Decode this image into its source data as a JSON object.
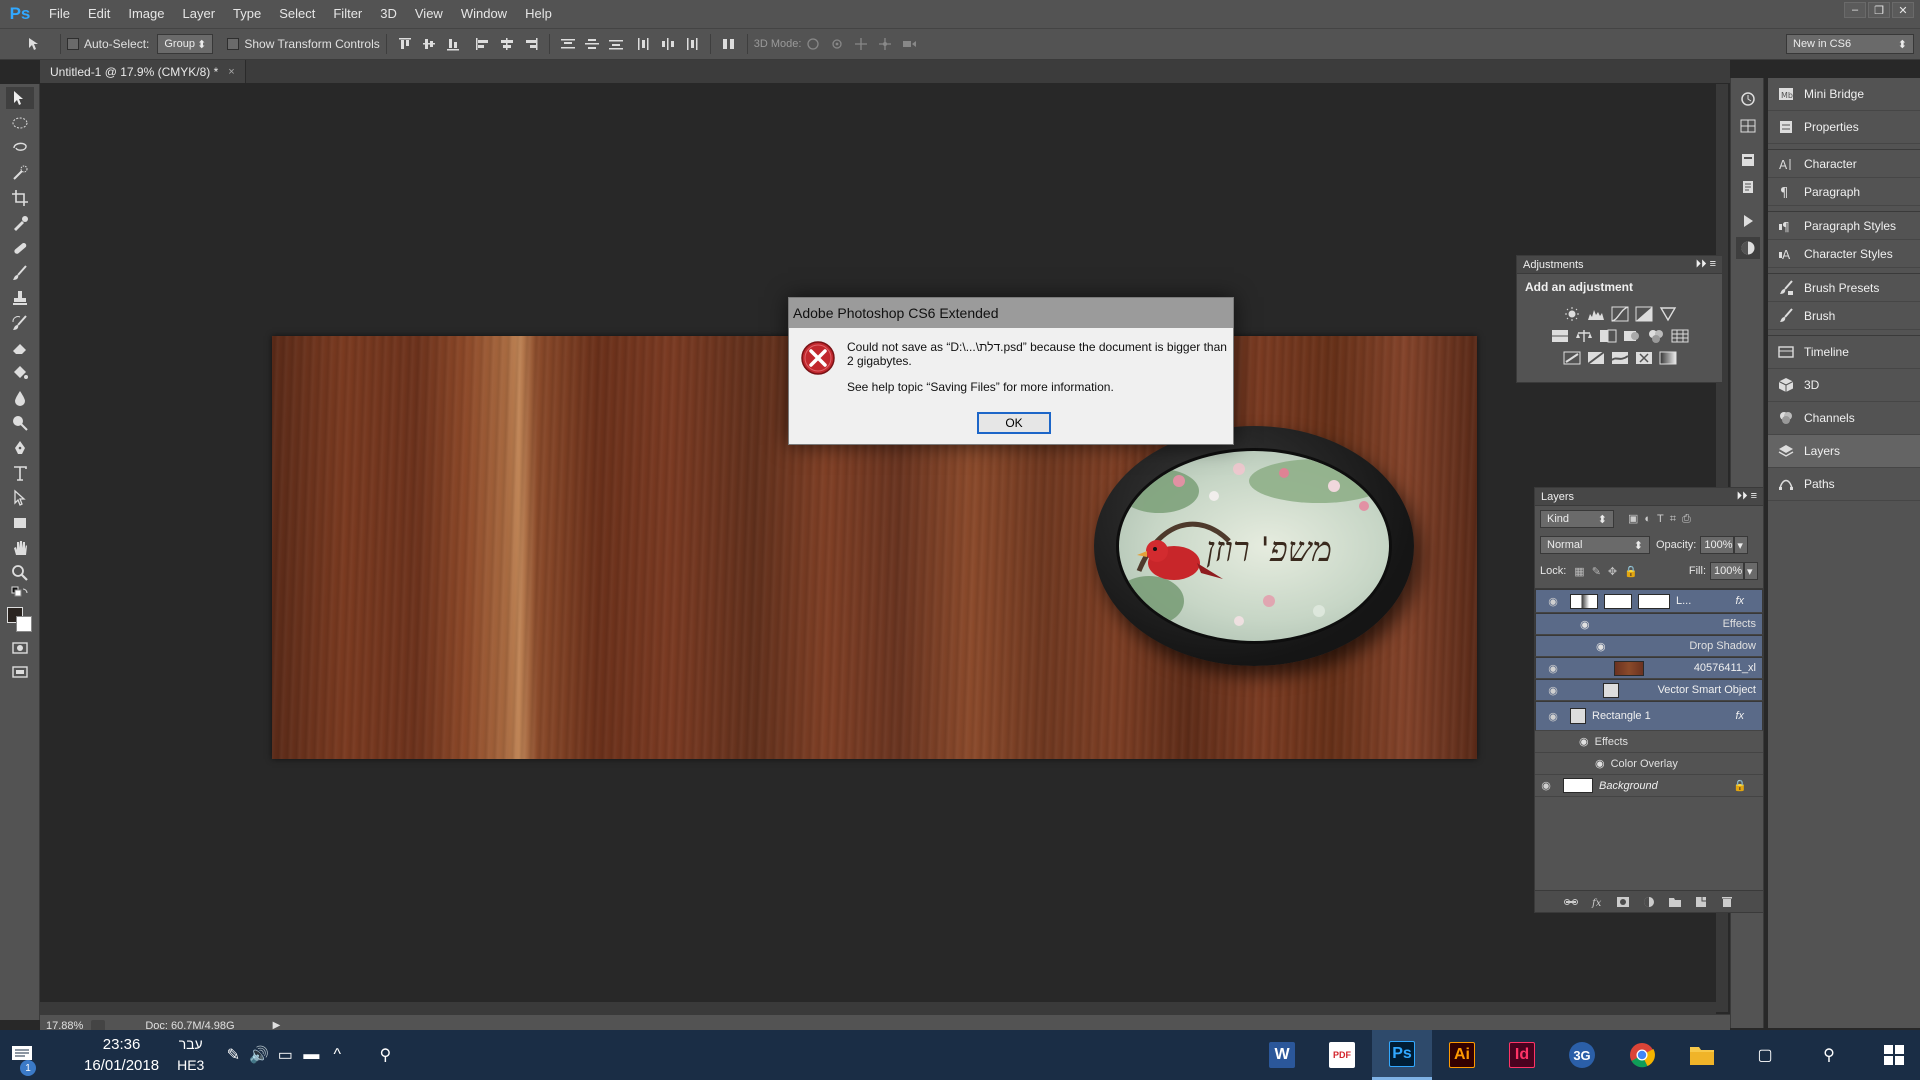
{
  "app": {
    "logo": "Ps",
    "menu": [
      "File",
      "Edit",
      "Image",
      "Layer",
      "Type",
      "Select",
      "Filter",
      "3D",
      "View",
      "Window",
      "Help"
    ]
  },
  "options": {
    "auto_select_label": "Auto-Select:",
    "auto_select_value": "Group",
    "transform_label": "Show Transform Controls",
    "mode3d_label": "3D Mode:",
    "workspace": "New in CS6"
  },
  "document": {
    "tab_title": "Untitled-1 @ 17.9% (CMYK/8) *",
    "tab_close": "×"
  },
  "status": {
    "zoom": "17.88%",
    "doc_size": "Doc: 60.7M/4.98G"
  },
  "panels_list": [
    "Mini Bridge",
    "Properties",
    "Character",
    "Paragraph",
    "Paragraph Styles",
    "Character Styles",
    "Brush Presets",
    "Brush",
    "Timeline",
    "3D",
    "Channels",
    "Layers",
    "Paths"
  ],
  "adjustments": {
    "title": "Adjustments",
    "subtitle": "Add an adjustment"
  },
  "layers": {
    "title": "Layers",
    "kind": "Kind",
    "blend_mode": "Normal",
    "opacity_label": "Opacity:",
    "opacity": "100%",
    "lock_label": "Lock:",
    "fill_label": "Fill:",
    "fill": "100%",
    "rows": [
      {
        "name": "L...",
        "fx": "fx",
        "effects": "Effects",
        "effect": "Drop Shadow"
      },
      {
        "name": "40576411_xl"
      },
      {
        "name": "Vector Smart Object"
      },
      {
        "name": "Rectangle 1",
        "fx": "fx",
        "effects": "Effects",
        "effect": "Color Overlay"
      },
      {
        "name": "Background"
      }
    ]
  },
  "dialog": {
    "title": "Adobe Photoshop CS6 Extended",
    "message": "Could not save as “D:\\...\\דלת.psd” because the document is bigger than 2 gigabytes.",
    "help": "See help topic “Saving Files” for more information.",
    "ok": "OK"
  },
  "plaque_text": "משפ' רוזן",
  "taskbar": {
    "time": "23:36",
    "date": "16/01/2018",
    "lang": "עבר",
    "lang_code": "HE3",
    "notifications": "1",
    "apps": [
      "W",
      "PDF",
      "Ps",
      "Ai",
      "Id",
      "3G",
      "Chrome",
      "Files"
    ]
  },
  "colors": {
    "ps_blue": "#31a8ff",
    "error_red": "#c1272d",
    "selection": "#5a6a88",
    "dialog_focus": "#1d66c8"
  }
}
